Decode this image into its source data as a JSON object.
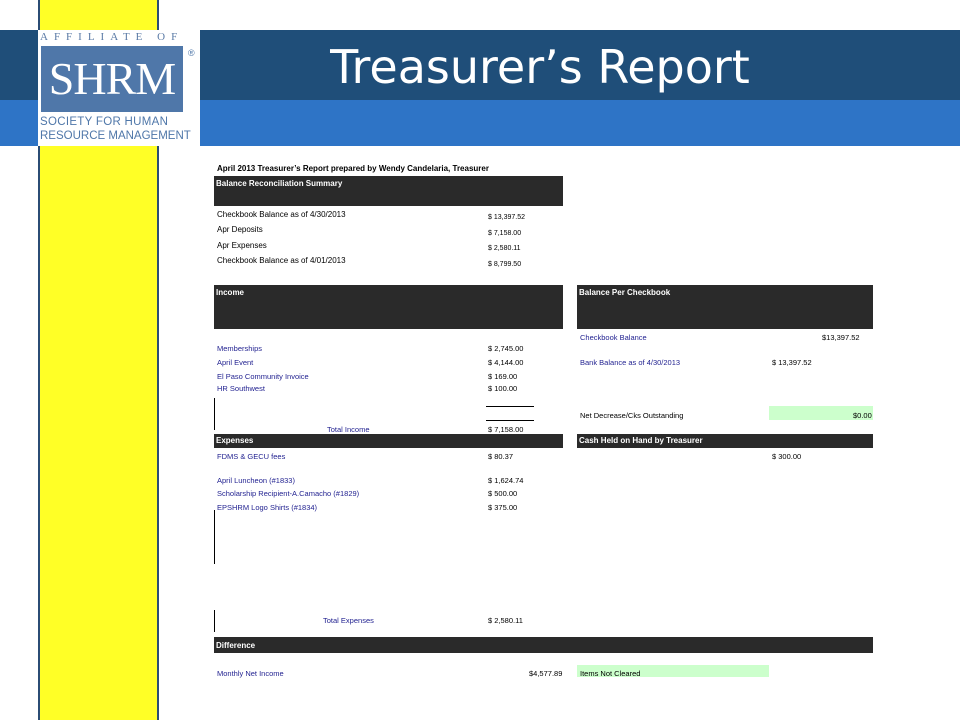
{
  "slide": {
    "title": "Treasurer’s Report",
    "logo": {
      "affiliate_text": "AFFILIATE OF",
      "mark": "SHRM",
      "registered": "®",
      "line1": "SOCIETY FOR HUMAN",
      "line2": "RESOURCE MANAGEMENT"
    }
  },
  "report": {
    "heading": "April 2013 Treasurer’s Report prepared by Wendy Candelaria, Treasurer",
    "summary": {
      "header": "Balance Reconciliation Summary",
      "rows": [
        {
          "label": "Checkbook Balance as of 4/30/2013",
          "value": "$  13,397.52"
        },
        {
          "label": "Apr Deposits",
          "value": "$   7,158.00"
        },
        {
          "label": "Apr Expenses",
          "value": "$   2,580.11"
        },
        {
          "label": "Checkbook Balance as of 4/01/2013",
          "value": "$   8,799.50"
        }
      ]
    },
    "income": {
      "header": "Income",
      "rows": [
        {
          "label": "Memberships",
          "value": "$   2,745.00"
        },
        {
          "label": "April Event",
          "value": "$   4,144.00"
        },
        {
          "label": "El Paso Community Invoice",
          "value": "$     169.00"
        },
        {
          "label": "HR Southwest",
          "value": "$     100.00"
        }
      ],
      "total_label": "Total Income",
      "total_value": "$   7,158.00"
    },
    "checkbook": {
      "header": "Balance Per Checkbook",
      "balance_label": "Checkbook Balance",
      "balance_value": "$13,397.52",
      "bank_label": "Bank Balance as of 4/30/2013",
      "bank_value": "$       13,397.52",
      "net_label": "Net Decrease/Cks  Outstanding",
      "net_value": "$0.00"
    },
    "expenses": {
      "header": "Expenses",
      "rows": [
        {
          "label": "FDMS & GECU fees",
          "value": "$      80.37"
        },
        {
          "label": "April Luncheon (#1833)",
          "value": "$   1,624.74"
        },
        {
          "label": "Scholarship Recipient-A.Camacho (#1829)",
          "value": "$     500.00"
        },
        {
          "label": "EPSHRM Logo Shirts (#1834)",
          "value": "$     375.00"
        }
      ],
      "total_label": "Total Expenses",
      "total_value": "$   2,580.11"
    },
    "cash": {
      "header": "Cash Held on Hand by Treasurer",
      "value": "$          300.00"
    },
    "difference": {
      "header": "Difference",
      "net_label": "Monthly Net Income",
      "net_value": "$4,577.89",
      "not_cleared_label": "Items Not Cleared"
    }
  }
}
